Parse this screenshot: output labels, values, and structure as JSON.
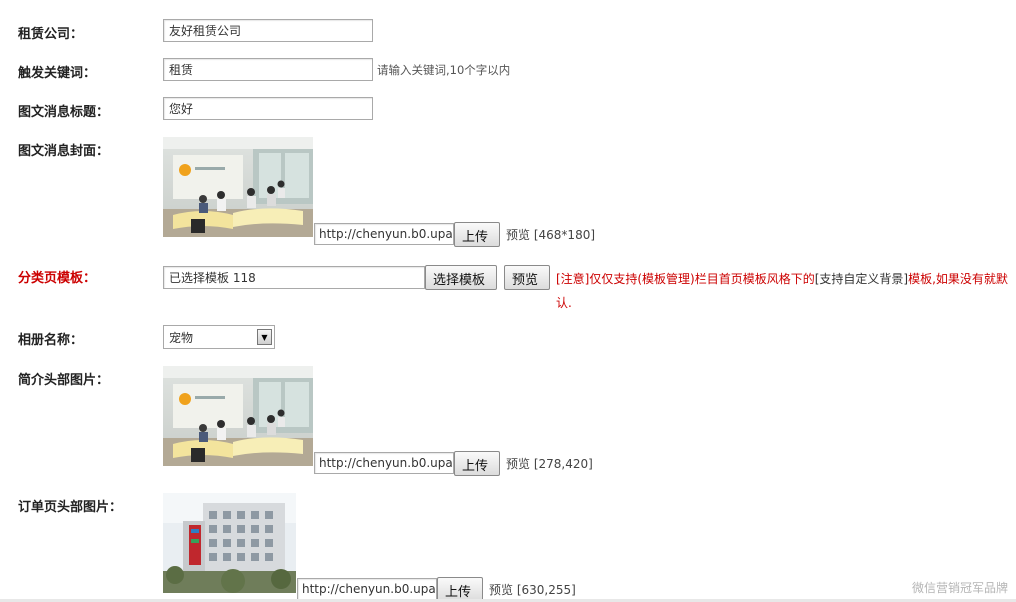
{
  "form": {
    "company": {
      "label": "租赁公司：",
      "value": "友好租赁公司"
    },
    "keyword": {
      "label": "触发关键词：",
      "value": "租赁",
      "hint": "请输入关键词,10个字以内"
    },
    "title": {
      "label": "图文消息标题：",
      "value": "您好"
    },
    "cover": {
      "label": "图文消息封面：",
      "url": "http://chenyun.b0.upaiyun",
      "upload": "上传",
      "preview": "预览",
      "size": "[468*180]"
    },
    "template": {
      "label": "分类页模板：",
      "value": "已选择模板 118",
      "select_btn": "选择模板",
      "preview_btn": "预览",
      "note_a": "[注意]仅仅支持(模板管理)栏目首页模板风格下的",
      "note_b": "[支持自定义背景]",
      "note_c": "模板,如果没有就默认."
    },
    "album": {
      "label": "相册名称：",
      "selected": "宠物"
    },
    "intro_header": {
      "label": "简介头部图片：",
      "url": "http://chenyun.b0.upaiyun",
      "upload": "上传",
      "preview": "预览",
      "size": "[278,420]"
    },
    "order_header": {
      "label": "订单页头部图片：",
      "url": "http://chenyun.b0.upaiyun",
      "upload": "上传",
      "preview": "预览",
      "size": "[630,255]"
    }
  },
  "watermark": "微信营销冠军品牌",
  "icons": {
    "dropdown": "chevron-down-icon"
  }
}
